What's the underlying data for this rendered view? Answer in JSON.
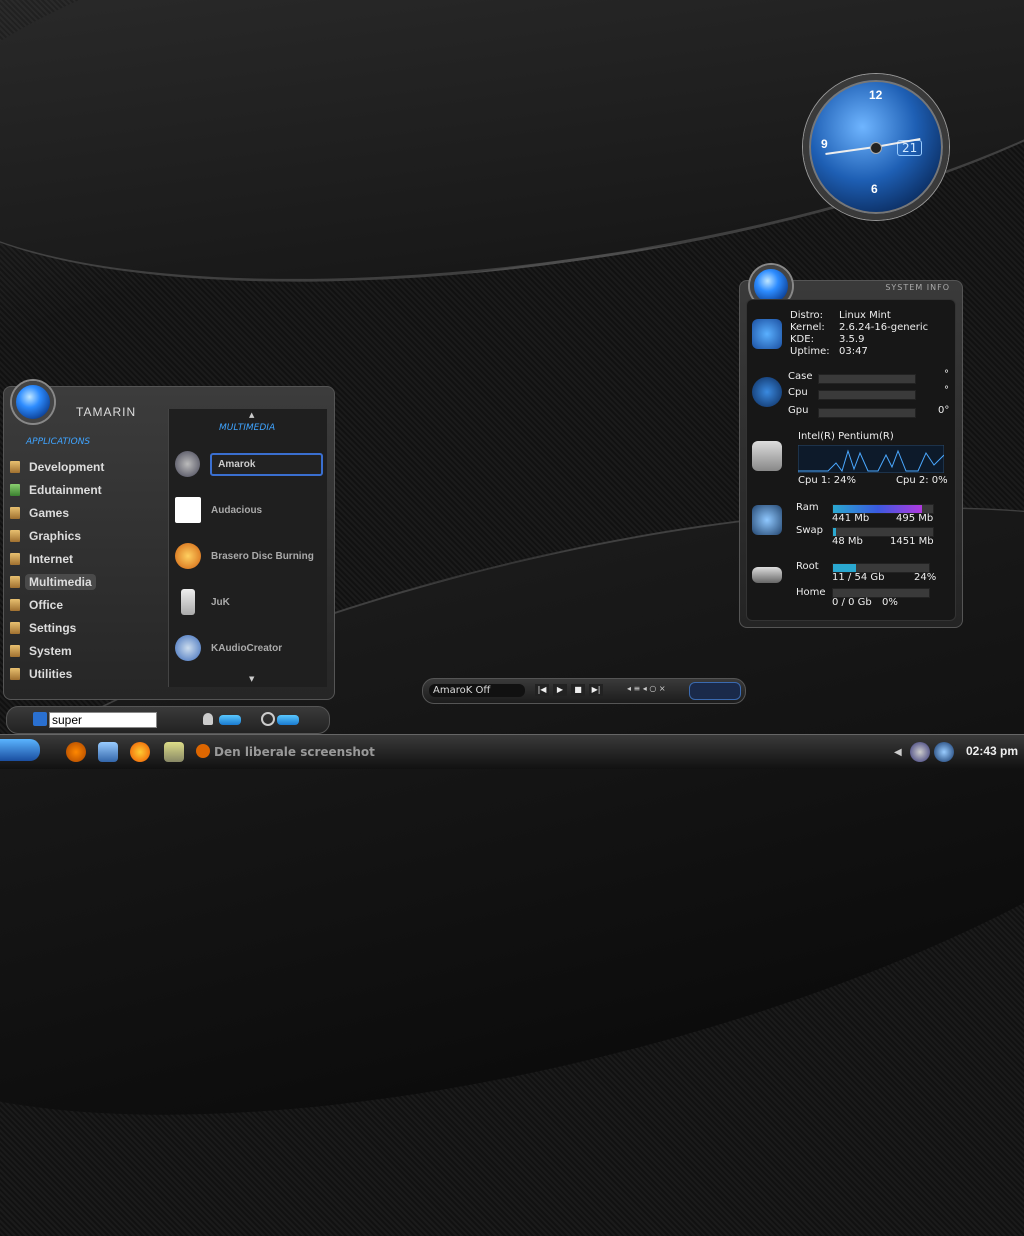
{
  "clock": {
    "n12": "12",
    "n9": "9",
    "n6": "6",
    "date": "21"
  },
  "sysinfo": {
    "title": "SYSTEM INFO",
    "rows": [
      {
        "k": "Distro:",
        "v": "Linux Mint"
      },
      {
        "k": "Kernel:",
        "v": "2.6.24-16-generic"
      },
      {
        "k": "KDE:",
        "v": "3.5.9"
      },
      {
        "k": "Uptime:",
        "v": "03:47"
      }
    ],
    "temps": [
      {
        "k": "Case",
        "v": "°"
      },
      {
        "k": "Cpu",
        "v": "°"
      },
      {
        "k": "Gpu",
        "v": "0°"
      }
    ],
    "cpu_name": "Intel(R) Pentium(R)",
    "cpu1": "Cpu 1: 24%",
    "cpu2": "Cpu 2: 0%",
    "ram": {
      "label": "Ram",
      "used": "441 Mb",
      "total": "495 Mb"
    },
    "swap": {
      "label": "Swap",
      "used": "48 Mb",
      "total": "1451 Mb"
    },
    "root": {
      "label": "Root",
      "value": "11 / 54 Gb",
      "pct": "24%"
    },
    "home": {
      "label": "Home",
      "value": "0 / 0 Gb",
      "pct": "0%"
    },
    "accent": "#2d8cff"
  },
  "menu": {
    "name": "TAMARIN",
    "applications_header": "APPLICATIONS",
    "categories": [
      "Development",
      "Edutainment",
      "Games",
      "Graphics",
      "Internet",
      "Multimedia",
      "Office",
      "Settings",
      "System",
      "Utilities"
    ],
    "selected": "Multimedia",
    "multimedia_header": "MULTIMEDIA",
    "apps": [
      "Amarok",
      "Audacious",
      "Brasero Disc Burning",
      "JuK",
      "KAudioCreator"
    ],
    "up_arrow": "▲",
    "down_arrow": "▼"
  },
  "search": {
    "value": "super"
  },
  "player": {
    "status": "AmaroK Off",
    "prev": "|◀",
    "play": "▶",
    "stop": "■",
    "next": "▶|",
    "controls": "◂ ≡ ◂ ○ ×"
  },
  "taskbar": {
    "task": "Den liberale screenshot",
    "time": "02:43 pm"
  }
}
